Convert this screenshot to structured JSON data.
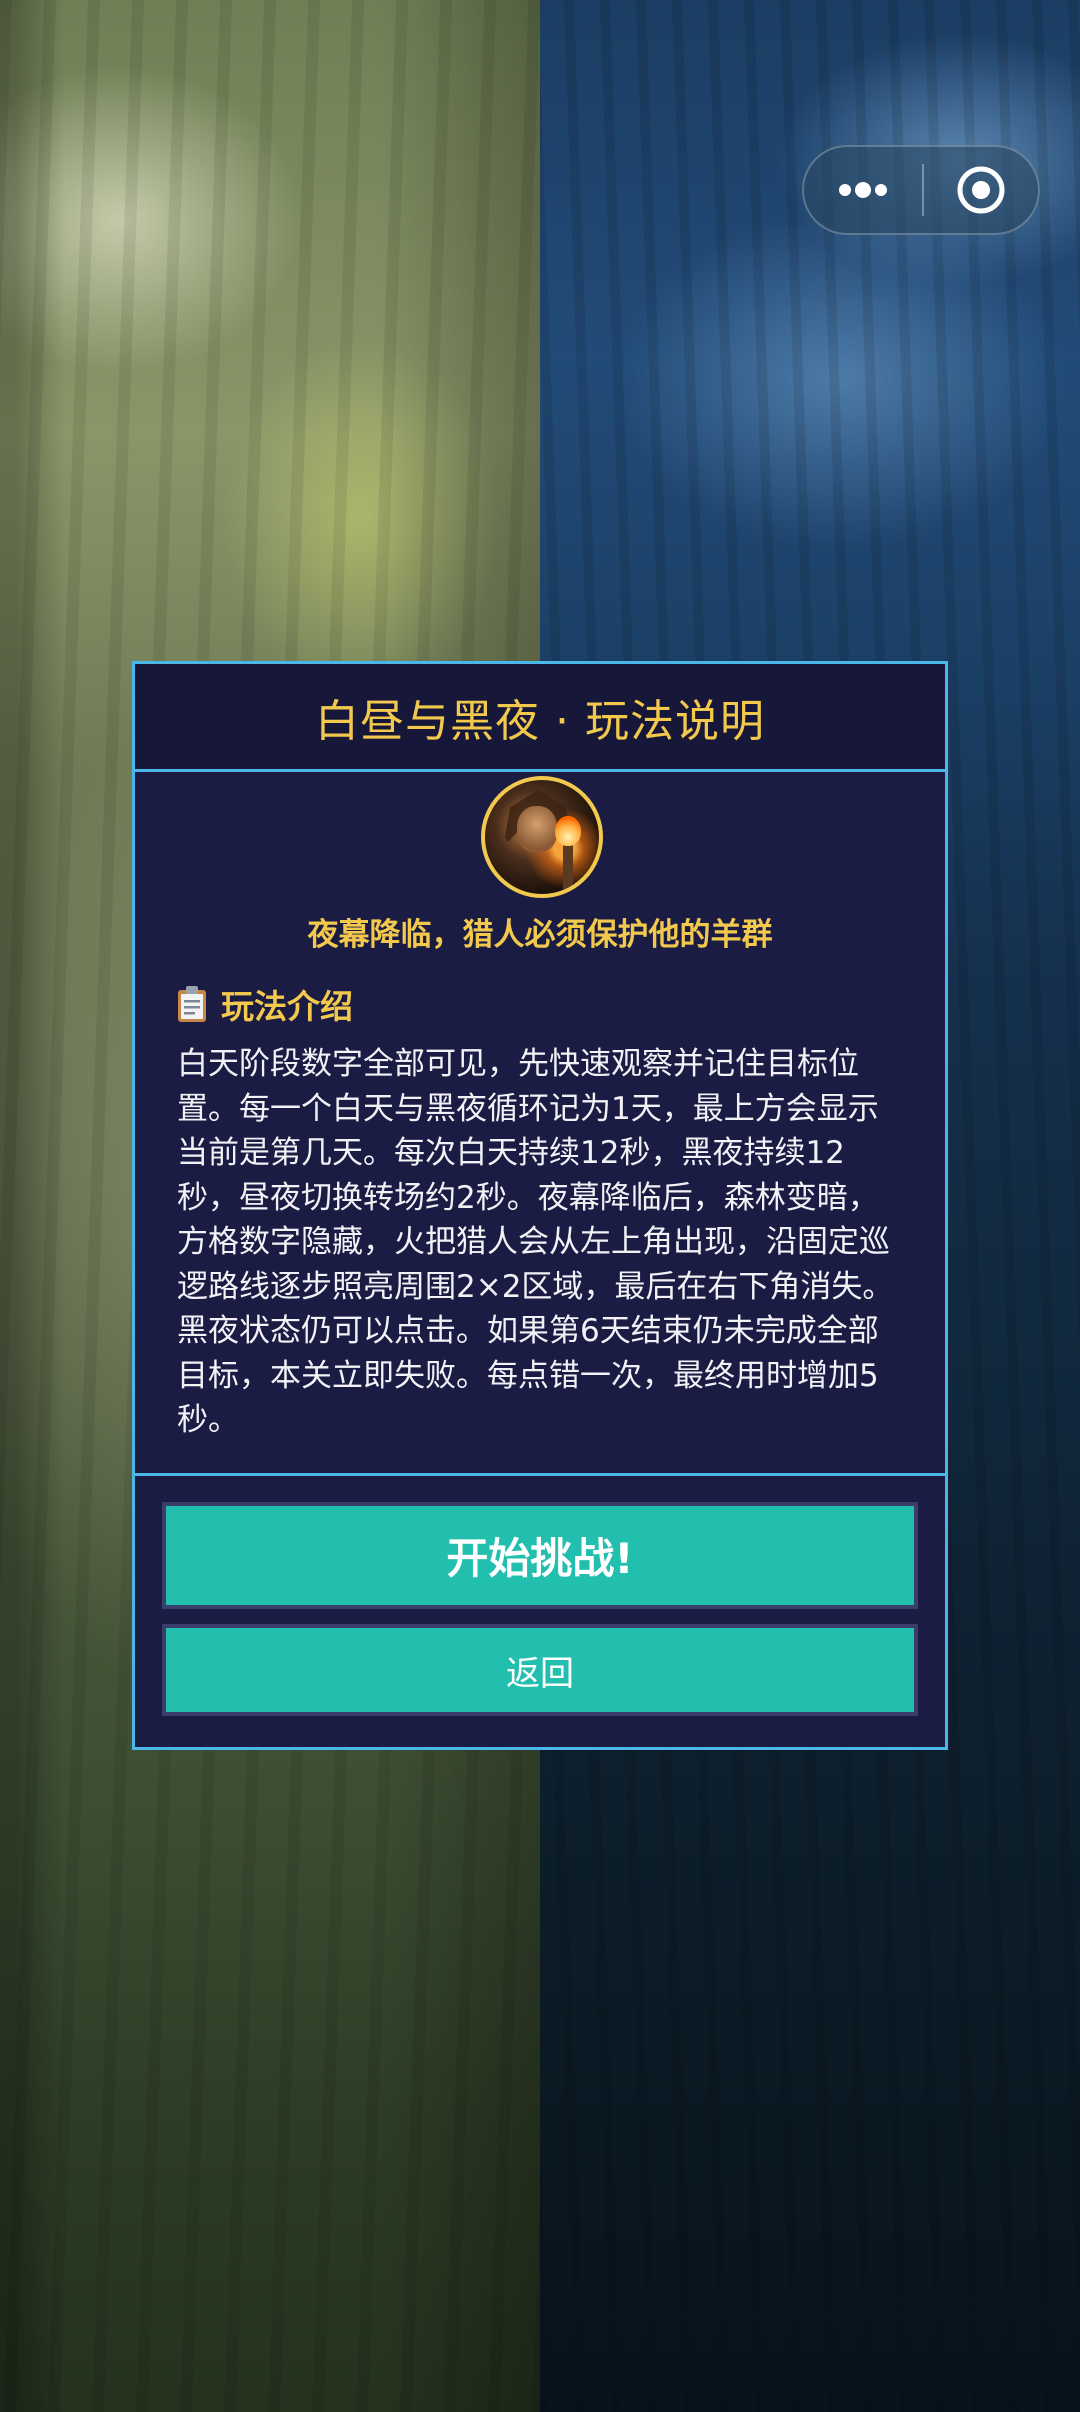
{
  "dialog": {
    "title": "白昼与黑夜 · 玩法说明",
    "subtitle": "夜幕降临，猎人必须保护他的羊群",
    "section_title": "玩法介绍",
    "description": "白天阶段数字全部可见，先快速观察并记住目标位置。每一个白天与黑夜循环记为1天，最上方会显示当前是第几天。每次白天持续12秒，黑夜持续12秒，昼夜切换转场约2秒。夜幕降临后，森林变暗，方格数字隐藏，火把猎人会从左上角出现，沿固定巡逻路线逐步照亮周围2×2区域，最后在右下角消失。黑夜状态仍可以点击。如果第6天结束仍未完成全部目标，本关立即失败。每点错一次，最终用时增加5秒。",
    "start_button": "开始挑战!",
    "back_button": "返回"
  },
  "icons": {
    "capsule_more": "more-dots-icon",
    "capsule_close": "target-close-icon",
    "section": "clipboard-icon",
    "avatar": "hunter-avatar"
  },
  "colors": {
    "accent_gold": "#f2c94c",
    "border_blue": "#4bb6e8",
    "panel_bg": "#1b1c44",
    "button_teal": "#22bfae"
  }
}
